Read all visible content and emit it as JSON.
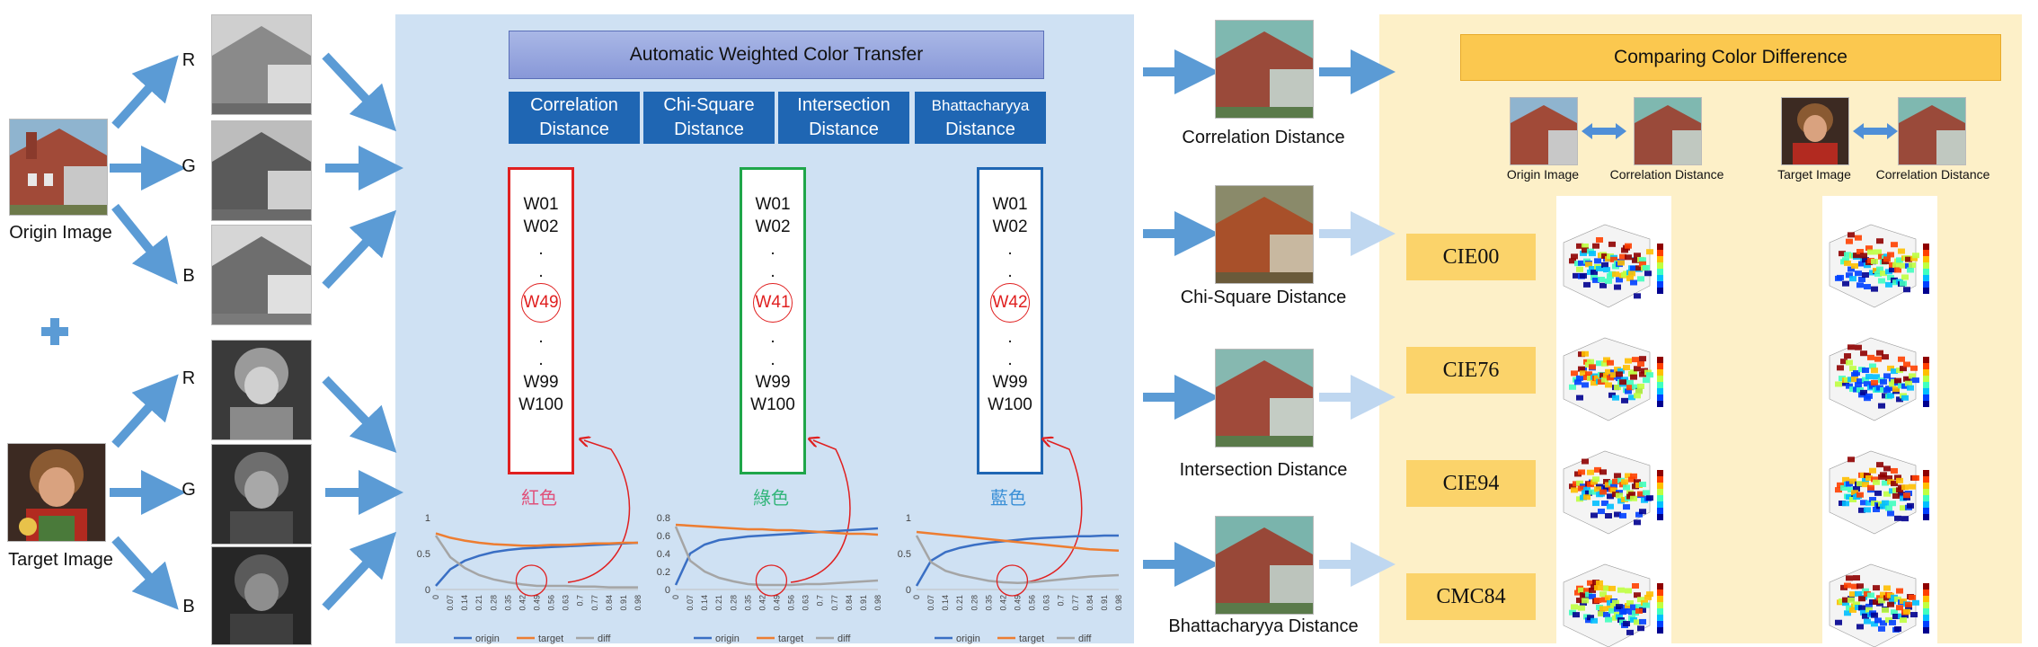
{
  "left": {
    "origin_label": "Origin Image",
    "target_label": "Target Image",
    "channels": [
      "R",
      "G",
      "B"
    ],
    "plus": "+"
  },
  "middle": {
    "title": "Automatic Weighted Color Transfer",
    "distances": [
      {
        "line1": "Correlation",
        "line2": "Distance"
      },
      {
        "line1": "Chi-Square",
        "line2": "Distance"
      },
      {
        "line1": "Intersection",
        "line2": "Distance"
      },
      {
        "line1": "Bhattacharyya",
        "line2": "Distance"
      }
    ],
    "weights": {
      "w01": "W01",
      "w02": "W02",
      "dot": ".",
      "w99": "W99",
      "w100": "W100",
      "red": "W49",
      "green": "W41",
      "blue": "W42"
    },
    "channel_names": {
      "red": "紅色",
      "green": "綠色",
      "blue": "藍色"
    },
    "colors": {
      "red": "#e02020",
      "green": "#1fa64a",
      "blue": "#1f66b3",
      "red_text": "#e0507a",
      "green_text": "#33b57a",
      "blue_text": "#3a8fd6"
    }
  },
  "chart_data": [
    {
      "type": "line",
      "x_ticks": [
        "0",
        "0.07",
        "0.14",
        "0.21",
        "0.28",
        "0.35",
        "0.42",
        "0.49",
        "0.56",
        "0.63",
        "0.7",
        "0.77",
        "0.84",
        "0.91",
        "0.98"
      ],
      "y_ticks": [
        "0",
        "0.5",
        "1"
      ],
      "ylim": [
        0,
        1
      ],
      "series": [
        {
          "name": "origin",
          "color": "#3a6fc4",
          "values": [
            0.05,
            0.28,
            0.4,
            0.47,
            0.52,
            0.55,
            0.57,
            0.58,
            0.59,
            0.6,
            0.61,
            0.62,
            0.63,
            0.64,
            0.65
          ]
        },
        {
          "name": "target",
          "color": "#ed7d31",
          "values": [
            0.78,
            0.72,
            0.68,
            0.65,
            0.63,
            0.62,
            0.61,
            0.61,
            0.62,
            0.62,
            0.63,
            0.64,
            0.64,
            0.65,
            0.65
          ]
        },
        {
          "name": "diff",
          "color": "#a5a5a5",
          "values": [
            0.75,
            0.45,
            0.3,
            0.2,
            0.14,
            0.1,
            0.07,
            0.05,
            0.05,
            0.05,
            0.04,
            0.04,
            0.03,
            0.03,
            0.03
          ]
        }
      ]
    },
    {
      "type": "line",
      "x_ticks": [
        "0",
        "0.07",
        "0.14",
        "0.21",
        "0.28",
        "0.35",
        "0.42",
        "0.49",
        "0.56",
        "0.63",
        "0.7",
        "0.77",
        "0.84",
        "0.91",
        "0.98"
      ],
      "y_ticks": [
        "0",
        "0.2",
        "0.4",
        "0.6",
        "0.8"
      ],
      "ylim": [
        0,
        0.8
      ],
      "series": [
        {
          "name": "origin",
          "color": "#3a6fc4",
          "values": [
            0.05,
            0.4,
            0.5,
            0.55,
            0.57,
            0.59,
            0.6,
            0.61,
            0.62,
            0.63,
            0.64,
            0.65,
            0.66,
            0.67,
            0.68
          ]
        },
        {
          "name": "target",
          "color": "#ed7d31",
          "values": [
            0.72,
            0.71,
            0.7,
            0.69,
            0.68,
            0.67,
            0.67,
            0.66,
            0.66,
            0.65,
            0.64,
            0.63,
            0.62,
            0.62,
            0.61
          ]
        },
        {
          "name": "diff",
          "color": "#a5a5a5",
          "values": [
            0.7,
            0.32,
            0.2,
            0.13,
            0.09,
            0.06,
            0.05,
            0.05,
            0.05,
            0.06,
            0.06,
            0.07,
            0.08,
            0.09,
            0.1
          ]
        }
      ]
    },
    {
      "type": "line",
      "x_ticks": [
        "0",
        "0.07",
        "0.14",
        "0.21",
        "0.28",
        "0.35",
        "0.42",
        "0.49",
        "0.56",
        "0.63",
        "0.7",
        "0.77",
        "0.84",
        "0.91",
        "0.98"
      ],
      "y_ticks": [
        "0",
        "0.5",
        "1"
      ],
      "ylim": [
        0,
        1
      ],
      "series": [
        {
          "name": "origin",
          "color": "#3a6fc4",
          "values": [
            0.05,
            0.4,
            0.52,
            0.58,
            0.62,
            0.65,
            0.67,
            0.69,
            0.71,
            0.72,
            0.73,
            0.74,
            0.74,
            0.75,
            0.75
          ]
        },
        {
          "name": "target",
          "color": "#ed7d31",
          "values": [
            0.8,
            0.78,
            0.76,
            0.74,
            0.72,
            0.7,
            0.68,
            0.66,
            0.64,
            0.62,
            0.6,
            0.58,
            0.56,
            0.55,
            0.54
          ]
        },
        {
          "name": "diff",
          "color": "#a5a5a5",
          "values": [
            0.75,
            0.38,
            0.26,
            0.2,
            0.16,
            0.12,
            0.1,
            0.09,
            0.1,
            0.12,
            0.14,
            0.16,
            0.18,
            0.19,
            0.2
          ]
        }
      ]
    }
  ],
  "results": {
    "labels": [
      "Correlation Distance",
      "Chi-Square Distance",
      "Intersection Distance",
      "Bhattacharyya Distance"
    ]
  },
  "right": {
    "title": "Comparing Color Difference",
    "pairs": [
      {
        "a": "Origin Image",
        "b": "Correlation Distance"
      },
      {
        "a": "Target Image",
        "b": "Correlation Distance"
      }
    ],
    "metrics": [
      "CIE00",
      "CIE76",
      "CIE94",
      "CMC84"
    ]
  }
}
